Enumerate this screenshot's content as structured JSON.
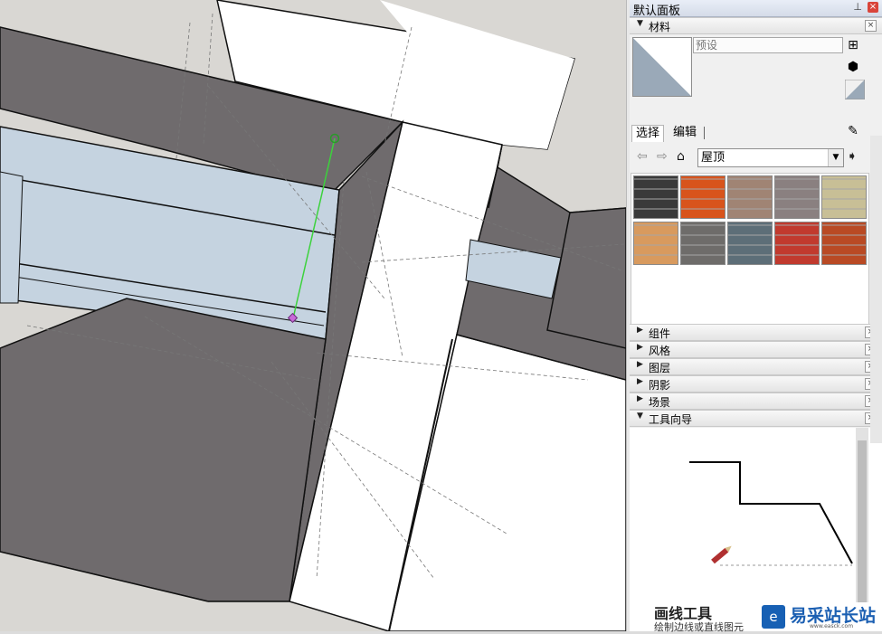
{
  "tray": {
    "title": "默认面板",
    "pin_icon": "pin-icon",
    "close_icon": "close-icon"
  },
  "materials": {
    "header": "材料",
    "name_value": "预设",
    "tabs": [
      "选择",
      "编辑"
    ],
    "collection": "屋顶",
    "swatches": [
      {
        "name": "black-shingle",
        "color": "#3a3a3a"
      },
      {
        "name": "orange-shingle",
        "color": "#d8541c"
      },
      {
        "name": "brown-stone-shingle",
        "color": "#a08474"
      },
      {
        "name": "gray-shingle",
        "color": "#8a8080"
      },
      {
        "name": "tan-shingle",
        "color": "#c8bf96"
      },
      {
        "name": "clay-scallop-shingle",
        "color": "#d89a5e"
      },
      {
        "name": "slate-gray-shingle",
        "color": "#6e6c6a"
      },
      {
        "name": "blue-slate-shingle",
        "color": "#5d6e78"
      },
      {
        "name": "red-metal-roof",
        "color": "#c13a2e"
      },
      {
        "name": "spanish-tile",
        "color": "#b94a24"
      }
    ]
  },
  "panels": [
    {
      "label": "组件",
      "expanded": false
    },
    {
      "label": "风格",
      "expanded": false
    },
    {
      "label": "图层",
      "expanded": false
    },
    {
      "label": "阴影",
      "expanded": false
    },
    {
      "label": "场景",
      "expanded": false
    },
    {
      "label": "工具向导",
      "expanded": true
    }
  ],
  "guide": {
    "title": "画线工具",
    "description": "绘制边线或直线图元"
  },
  "watermark": {
    "text": "易采站长站",
    "sub": "www.easck.com"
  },
  "colors": {
    "wall_dark": "#6f6b6d",
    "wall_face": "#ffffff",
    "glass": "#c5d3e0",
    "background": "#d9d7d3",
    "inference_line": "#3cd23c",
    "endpoint": "#c86ad8"
  }
}
